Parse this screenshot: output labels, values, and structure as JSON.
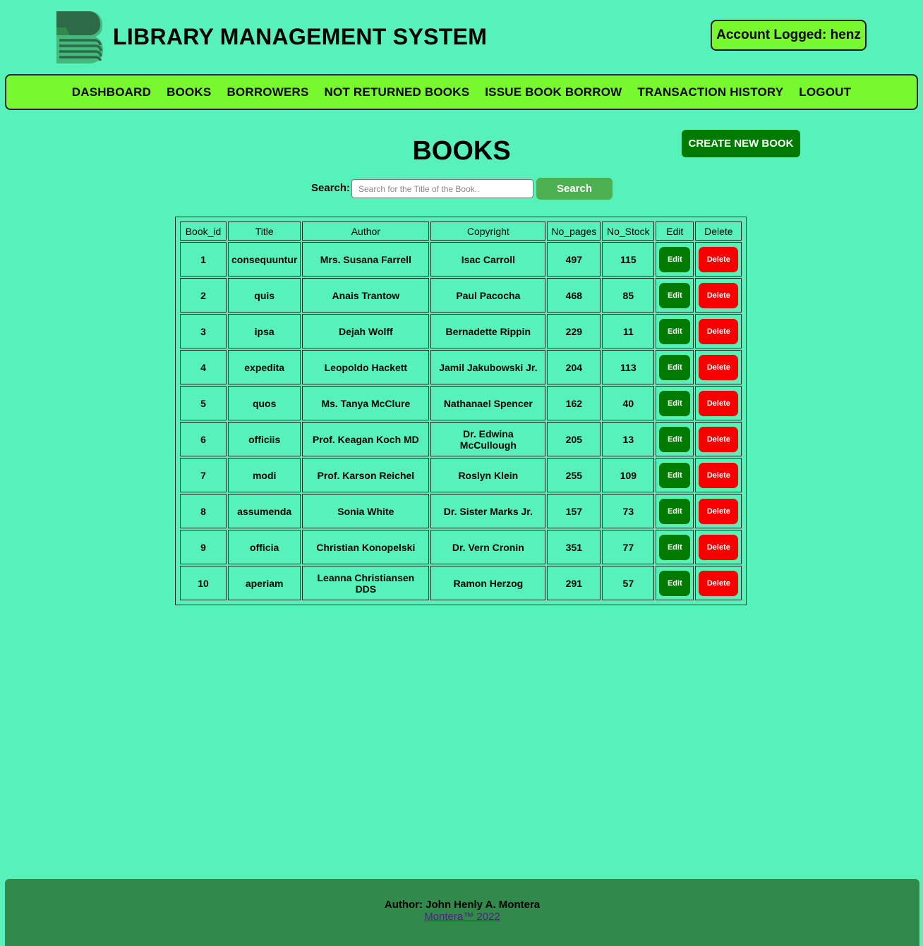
{
  "header": {
    "logo": "library-book-logo",
    "title": "LIBRARY MANAGEMENT SYSTEM",
    "account": "Account Logged: henz"
  },
  "nav": [
    "DASHBOARD",
    "BOOKS",
    "BORROWERS",
    "NOT RETURNED BOOKS",
    "ISSUE BOOK BORROW",
    "TRANSACTION HISTORY",
    "LOGOUT"
  ],
  "page": {
    "title": "BOOKS",
    "create_button": "CREATE NEW BOOK"
  },
  "search": {
    "label": "Search:",
    "placeholder": "Search for the Title of the Book..",
    "button": "Search"
  },
  "table": {
    "columns": [
      "Book_id",
      "Title",
      "Author",
      "Copyright",
      "No_pages",
      "No_Stock",
      "Edit",
      "Delete"
    ],
    "edit_label": "Edit",
    "delete_label": "Delete",
    "rows": [
      [
        "1",
        "consequuntur",
        "Mrs. Susana Farrell",
        "Isac Carroll",
        "497",
        "115"
      ],
      [
        "2",
        "quis",
        "Anais Trantow",
        "Paul Pacocha",
        "468",
        "85"
      ],
      [
        "3",
        "ipsa",
        "Dejah Wolff",
        "Bernadette Rippin",
        "229",
        "11"
      ],
      [
        "4",
        "expedita",
        "Leopoldo Hackett",
        "Jamil Jakubowski Jr.",
        "204",
        "113"
      ],
      [
        "5",
        "quos",
        "Ms. Tanya McClure",
        "Nathanael Spencer",
        "162",
        "40"
      ],
      [
        "6",
        "officiis",
        "Prof. Keagan Koch MD",
        "Dr. Edwina McCullough",
        "205",
        "13"
      ],
      [
        "7",
        "modi",
        "Prof. Karson Reichel",
        "Roslyn Klein",
        "255",
        "109"
      ],
      [
        "8",
        "assumenda",
        "Sonia White",
        "Dr. Sister Marks Jr.",
        "157",
        "73"
      ],
      [
        "9",
        "officia",
        "Christian Konopelski",
        "Dr. Vern Cronin",
        "351",
        "77"
      ],
      [
        "10",
        "aperiam",
        "Leanna Christiansen DDS",
        "Ramon Herzog",
        "291",
        "57"
      ]
    ]
  },
  "footer": {
    "author": "Author: John Henly A. Montera",
    "copyright": "Montera™ 2022"
  },
  "colors": {
    "background": "#57f2b9",
    "nav_bg": "#77f82f",
    "primary_green": "#007a00",
    "delete_red": "#f80000",
    "search_green": "#4caf50",
    "footer_bg": "#318a4c"
  }
}
